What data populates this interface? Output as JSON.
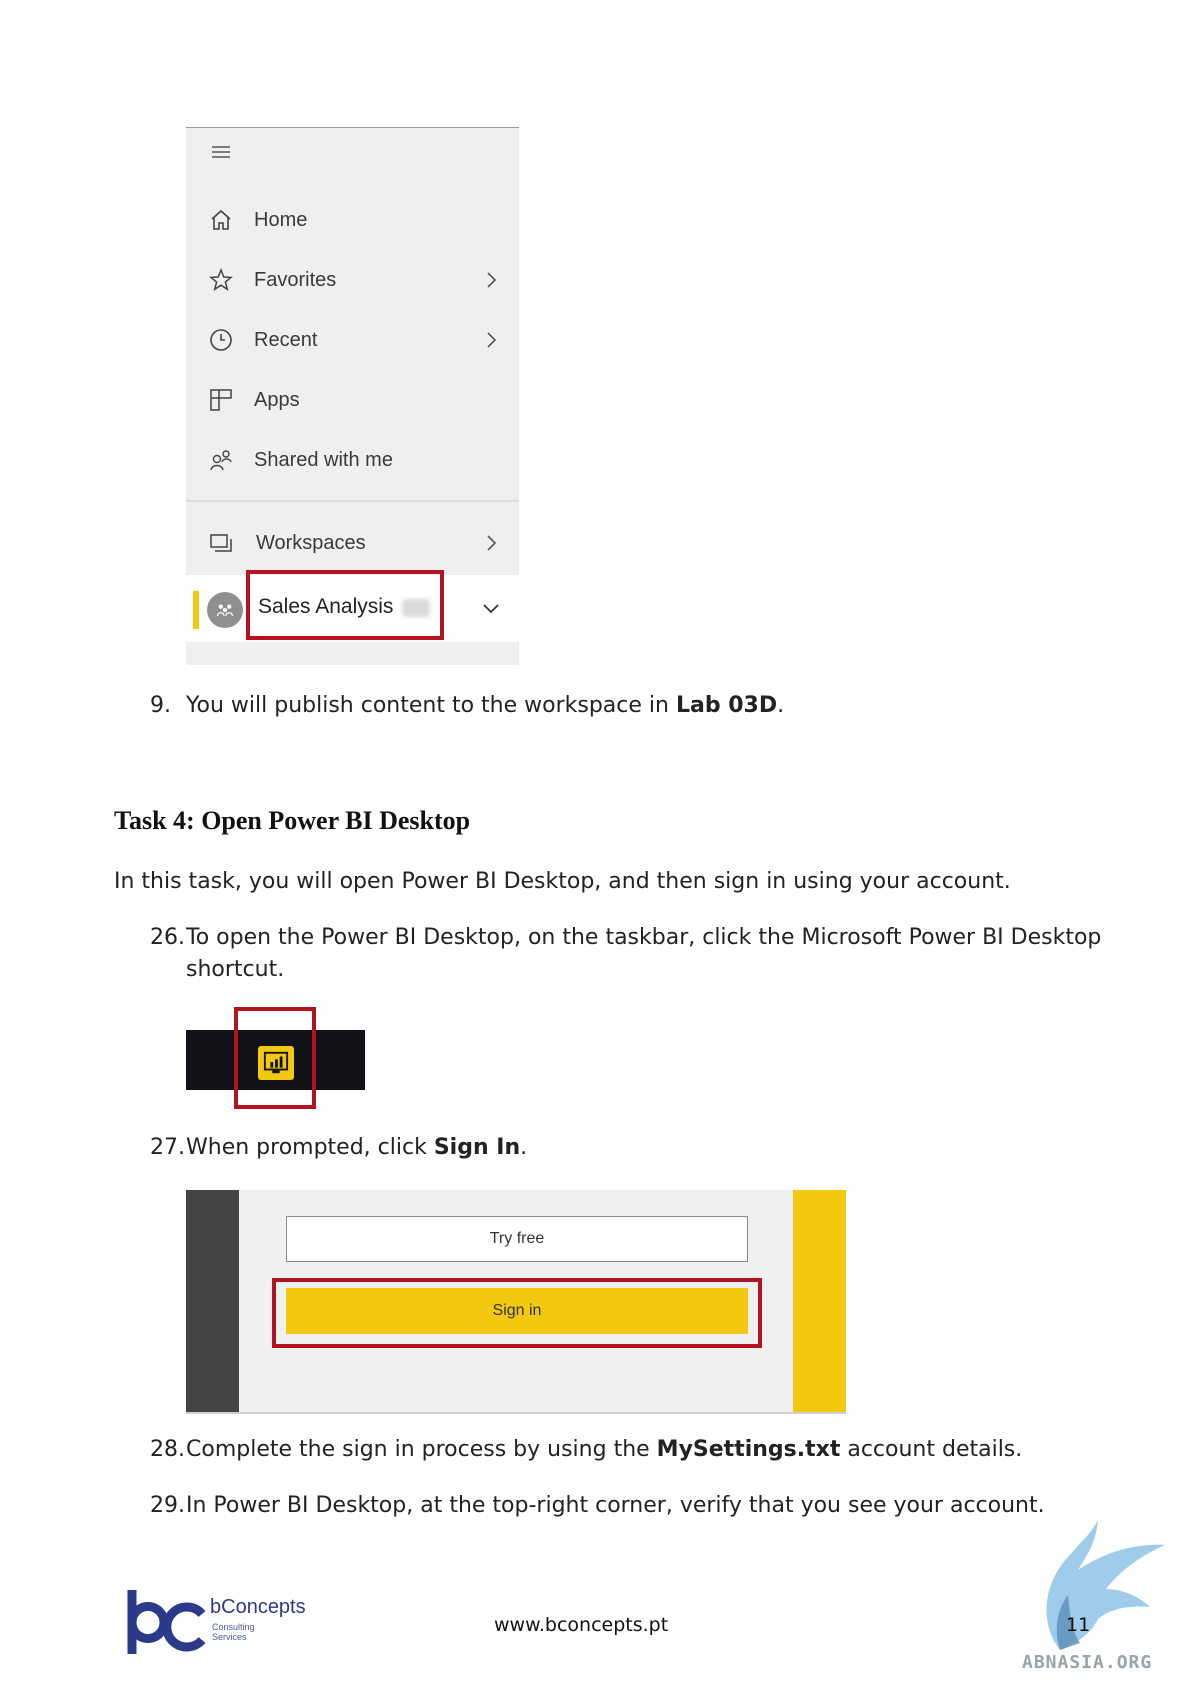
{
  "nav": {
    "items": [
      {
        "label": "Home",
        "icon": "home-icon"
      },
      {
        "label": "Favorites",
        "icon": "star-icon",
        "chevron": true
      },
      {
        "label": "Recent",
        "icon": "clock-icon",
        "chevron": true
      },
      {
        "label": "Apps",
        "icon": "apps-icon"
      },
      {
        "label": "Shared with me",
        "icon": "shared-icon"
      }
    ],
    "workspaces_label": "Workspaces",
    "active_workspace": "Sales Analysis"
  },
  "step9": {
    "number": "9.",
    "text_before": "You will publish content to the workspace in ",
    "bold": "Lab 03D",
    "text_after": "."
  },
  "task": {
    "heading": "Task 4: Open Power BI Desktop",
    "intro": "In this task, you will open Power BI Desktop, and then sign in using your account."
  },
  "step26": {
    "number": "26.",
    "line1": "To open the Power BI Desktop, on the taskbar, click the Microsoft Power BI Desktop",
    "line2": "shortcut."
  },
  "step27": {
    "number": "27.",
    "text_before": "When prompted, click ",
    "bold": "Sign In",
    "text_after": "."
  },
  "signin": {
    "try_free": "Try free",
    "sign_in": "Sign in"
  },
  "step28": {
    "number": "28.",
    "text_before": "Complete the sign in process by using the ",
    "bold": "MySettings.txt",
    "text_after": " account details."
  },
  "step29": {
    "number": "29.",
    "text": "In Power BI Desktop, at the top-right corner, verify that you see your account."
  },
  "footer": {
    "company": "bConcepts",
    "company_sub1": "Consulting",
    "company_sub2": "Services",
    "url": "www.bconcepts.pt",
    "page": "11",
    "watermark": "ABNASIA.ORG"
  },
  "colors": {
    "accent_yellow": "#f2c811",
    "highlight_red": "#b3121f",
    "brand_blue": "#2b3a8a"
  }
}
